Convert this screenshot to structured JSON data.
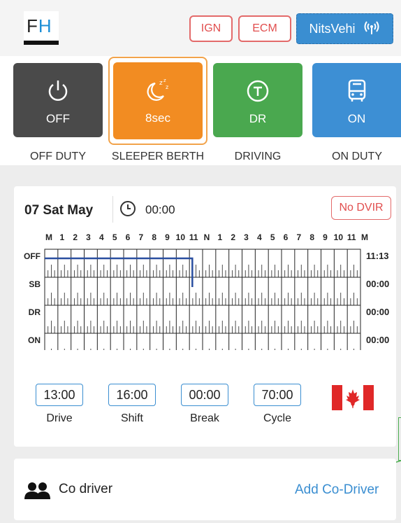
{
  "header": {
    "logo_text_f": "F",
    "logo_text_h": "H",
    "ign_label": "IGN",
    "ecm_label": "ECM",
    "vehicle_label": "NitsVehi",
    "vehicle_icon": "antenna-signal-icon"
  },
  "statuses": [
    {
      "key": "off",
      "value": "OFF",
      "label": "OFF DUTY",
      "icon": "power-icon",
      "color": "#4a4a4a"
    },
    {
      "key": "sb",
      "value": "8sec",
      "label": "SLEEPER BERTH",
      "icon": "sleep-moon-icon",
      "color": "#f28c22",
      "selected": true
    },
    {
      "key": "dr",
      "value": "DR",
      "label": "DRIVING",
      "icon": "steering-icon",
      "color": "#4aa84f"
    },
    {
      "key": "on",
      "value": "ON",
      "label": "ON DUTY",
      "icon": "bus-icon",
      "color": "#3d8fd4"
    }
  ],
  "log": {
    "date": "07 Sat May",
    "time": "00:00",
    "dvir_label": "No DVIR",
    "hour_labels": [
      "M",
      "1",
      "2",
      "3",
      "4",
      "5",
      "6",
      "7",
      "8",
      "9",
      "10",
      "11",
      "N",
      "1",
      "2",
      "3",
      "4",
      "5",
      "6",
      "7",
      "8",
      "9",
      "10",
      "11",
      "M"
    ],
    "rows": [
      {
        "label": "OFF",
        "total": "11:13"
      },
      {
        "label": "SB",
        "total": "00:00"
      },
      {
        "label": "DR",
        "total": "00:00"
      },
      {
        "label": "ON",
        "total": "00:00"
      }
    ]
  },
  "summary": [
    {
      "value": "13:00",
      "label": "Drive"
    },
    {
      "value": "16:00",
      "label": "Shift"
    },
    {
      "value": "00:00",
      "label": "Break"
    },
    {
      "value": "70:00",
      "label": "Cycle"
    }
  ],
  "codriver": {
    "label": "Co driver",
    "add_label": "Add Co-Driver"
  },
  "colors": {
    "accent": "#3a8ed1",
    "alert": "#e14e4e",
    "graph_line": "#2a4fa0"
  }
}
